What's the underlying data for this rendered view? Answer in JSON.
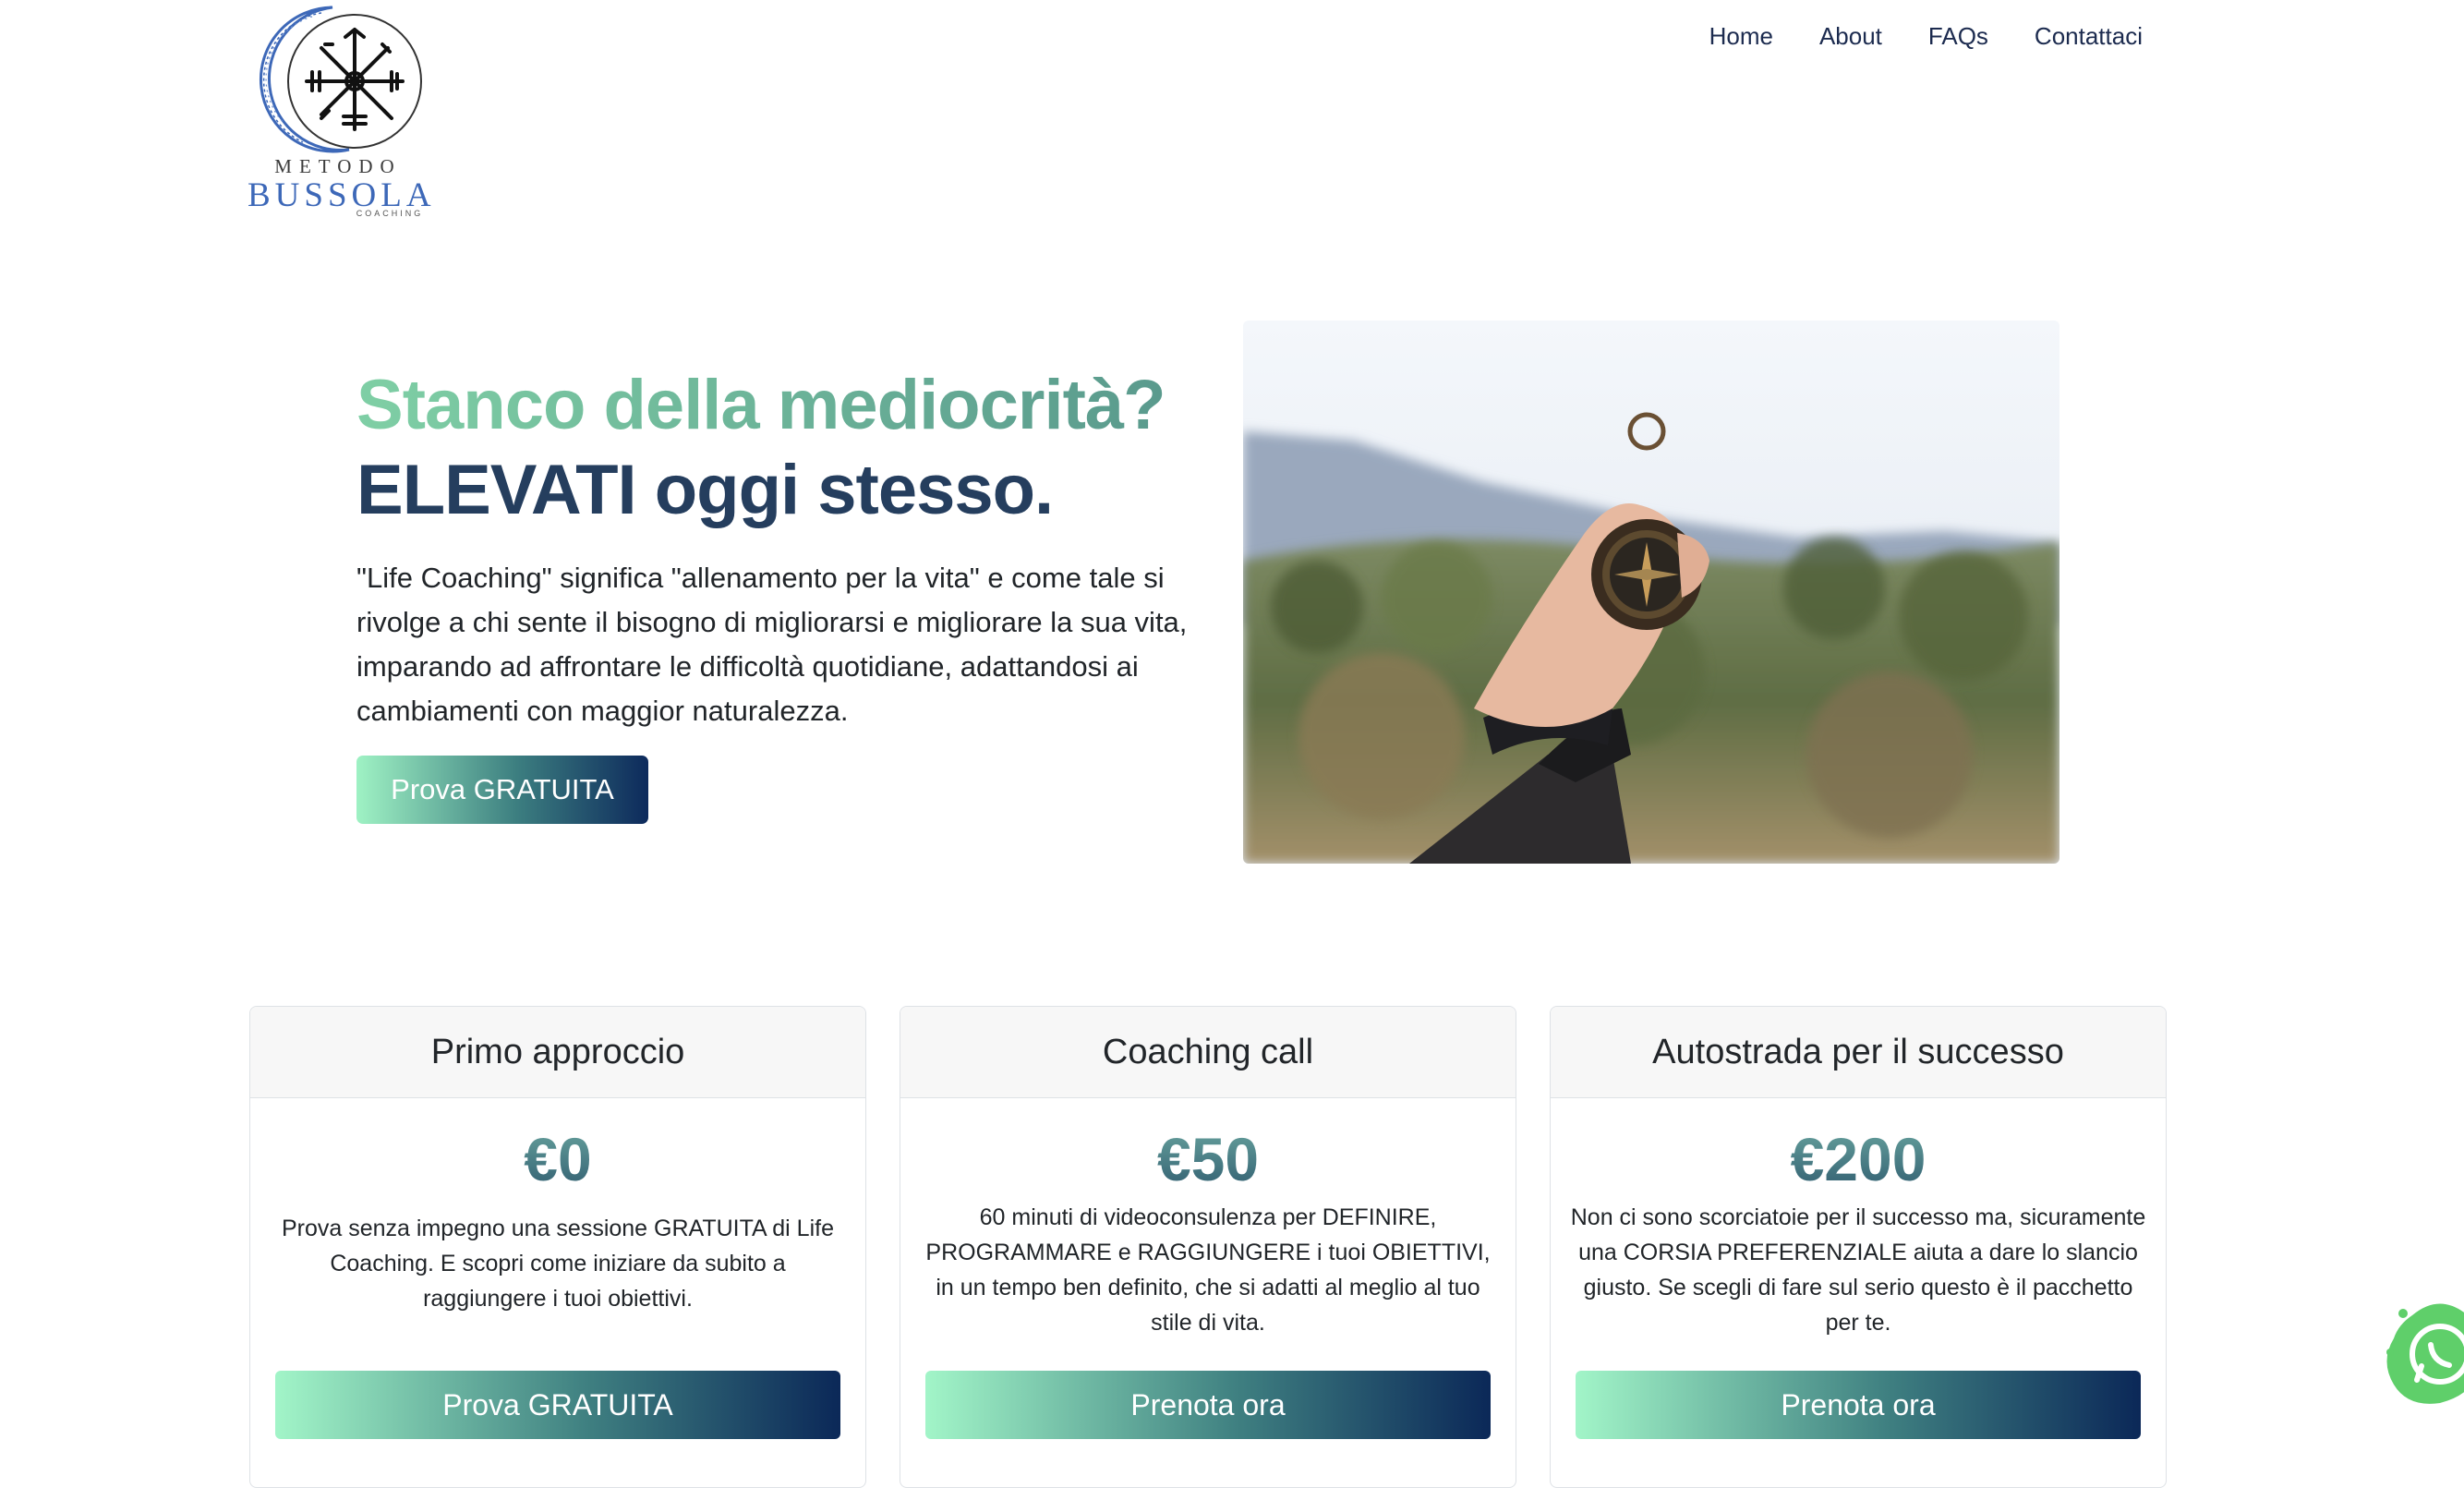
{
  "brand": {
    "logo_line1": "METODO",
    "logo_line2": "BUSSOLA",
    "logo_line3": "COACHING"
  },
  "nav": {
    "items": [
      "Home",
      "About",
      "FAQs",
      "Contattaci"
    ]
  },
  "hero": {
    "title_line1": "Stanco della mediocrità?",
    "title_line2": "ELEVATI oggi stesso.",
    "text": "\"Life Coaching\" significa \"allenamento per la vita\" e come tale si rivolge a chi sente il bisogno di migliorarsi e migliorare la sua vita, imparando ad affrontare le difficoltà quotidiane, adattandosi ai cambiamenti con maggior naturalezza.",
    "cta": "Prova GRATUITA"
  },
  "pricing": [
    {
      "title": "Primo approccio",
      "price": "€0",
      "description": "Prova senza impegno una sessione GRATUITA di Life Coaching. E scopri come iniziare da subito a raggiungere i tuoi obiettivi.",
      "cta": "Prova GRATUITA"
    },
    {
      "title": "Coaching call",
      "price": "€50",
      "description": "60 minuti di videoconsulenza per DEFINIRE, PROGRAMMARE e RAGGIUNGERE i tuoi OBIETTIVI, in un tempo ben definito, che si adatti al meglio al tuo stile di vita.",
      "cta": "Prenota ora"
    },
    {
      "title": "Autostrada per il successo",
      "price": "€200",
      "description": "Non ci sono scorciatoie per il successo ma, sicuramente una CORSIA PREFERENZIALE aiuta a dare lo slancio giusto. Se scegli di fare sul serio questo è il pacchetto per te.",
      "cta": "Prenota ora"
    }
  ],
  "icons": {
    "logo": "compass-rune-logo-icon",
    "floating": "whatsapp-icon"
  },
  "colors": {
    "accent_start": "#9ff2c4",
    "accent_end": "#0d2a5c",
    "title_dark": "#253e5e",
    "title_green": "#7fcfa5"
  }
}
